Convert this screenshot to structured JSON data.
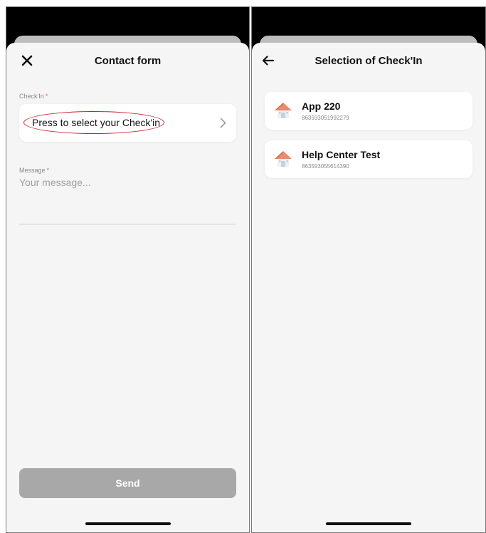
{
  "contact_form": {
    "close_icon": "close-icon",
    "title": "Contact form",
    "checkin_label": "Check'In",
    "required_mark": "*",
    "checkin_select_text": "Press to select your Check'in",
    "chevron_icon": "chevron-right-icon",
    "message_label": "Message",
    "message_placeholder": "Your message...",
    "send_label": "Send"
  },
  "selection": {
    "back_icon": "arrow-left-icon",
    "title": "Selection of Check'In",
    "items": [
      {
        "name": "App 220",
        "number": "863593051992279",
        "icon": "house-icon"
      },
      {
        "name": "Help Center Test",
        "number": "863593055614390",
        "icon": "house-icon"
      }
    ]
  },
  "colors": {
    "highlight_oval": "#c8202c",
    "required": "#e06666",
    "send_disabled": "#a8a8a8",
    "sheet_background": "#f5f5f5"
  }
}
